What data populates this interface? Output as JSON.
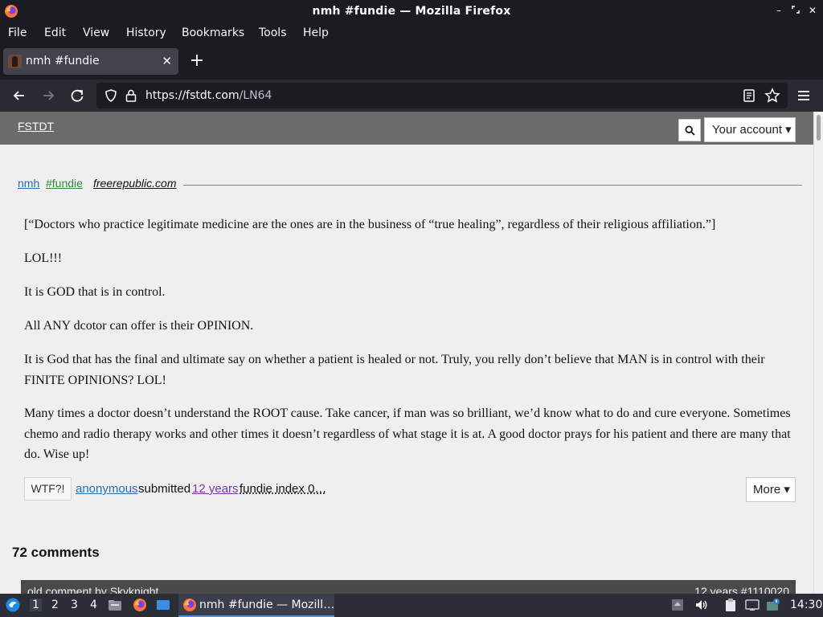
{
  "window": {
    "title": "nmh #fundie — Mozilla Firefox"
  },
  "menu": [
    "File",
    "Edit",
    "View",
    "History",
    "Bookmarks",
    "Tools",
    "Help"
  ],
  "tab": {
    "title": "nmh #fundie"
  },
  "urlbar": {
    "host": "https://fstdt.com",
    "path": "/LN64"
  },
  "site": {
    "brand": "FSTDT",
    "account_label": "Your account ▾",
    "search_icon": "magnifier"
  },
  "quote": {
    "author": "nmh",
    "tag": "#fundie",
    "source": "freerepublic.com",
    "paragraphs": [
      "[“Doctors who practice legitimate medicine are the ones are in the business of “true healing”, regardless of their religious affiliation.”]",
      "LOL!!!",
      "It is GOD that is in control.",
      "All ANY dcotor can offer is their OPINION.",
      "It is God that has the final and ultimate say on whether a patient is healed or not. Truly, you relly don’t believe that MAN is in control with their FINITE OPINIONS? LOL!",
      "Many times a doctor doesn’t understand the ROOT cause. Take cancer, if man was so brilliant, we’d know what to do and cure everyone. Sometimes chemo and radio therapy works and other times it doesn’t regardless of what stage it is at. A good doctor prays for his patient and there are many that do. Wise up!"
    ]
  },
  "footer": {
    "wtf_label": "WTF?!",
    "submitter": "anonymous",
    "submitted_text": "submitted",
    "age": "12 years",
    "index_text": "fundie index 0…",
    "more_label": "More ▾"
  },
  "comments": {
    "title": "72 comments",
    "first_left": "old comment by Skyknight",
    "first_right": "12 years #1110020"
  },
  "taskbar": {
    "workspaces": [
      "1",
      "2",
      "3",
      "4"
    ],
    "task_label": "nmh #fundie — Mozill…",
    "clock": "14:30"
  },
  "colors": {
    "chrome_dark": "#1c1b22",
    "site_header": "#6b6b6b",
    "link_blue": "#2a6db6",
    "tag_green": "#2e8b3a",
    "visited_purple": "#7a3aa8"
  }
}
